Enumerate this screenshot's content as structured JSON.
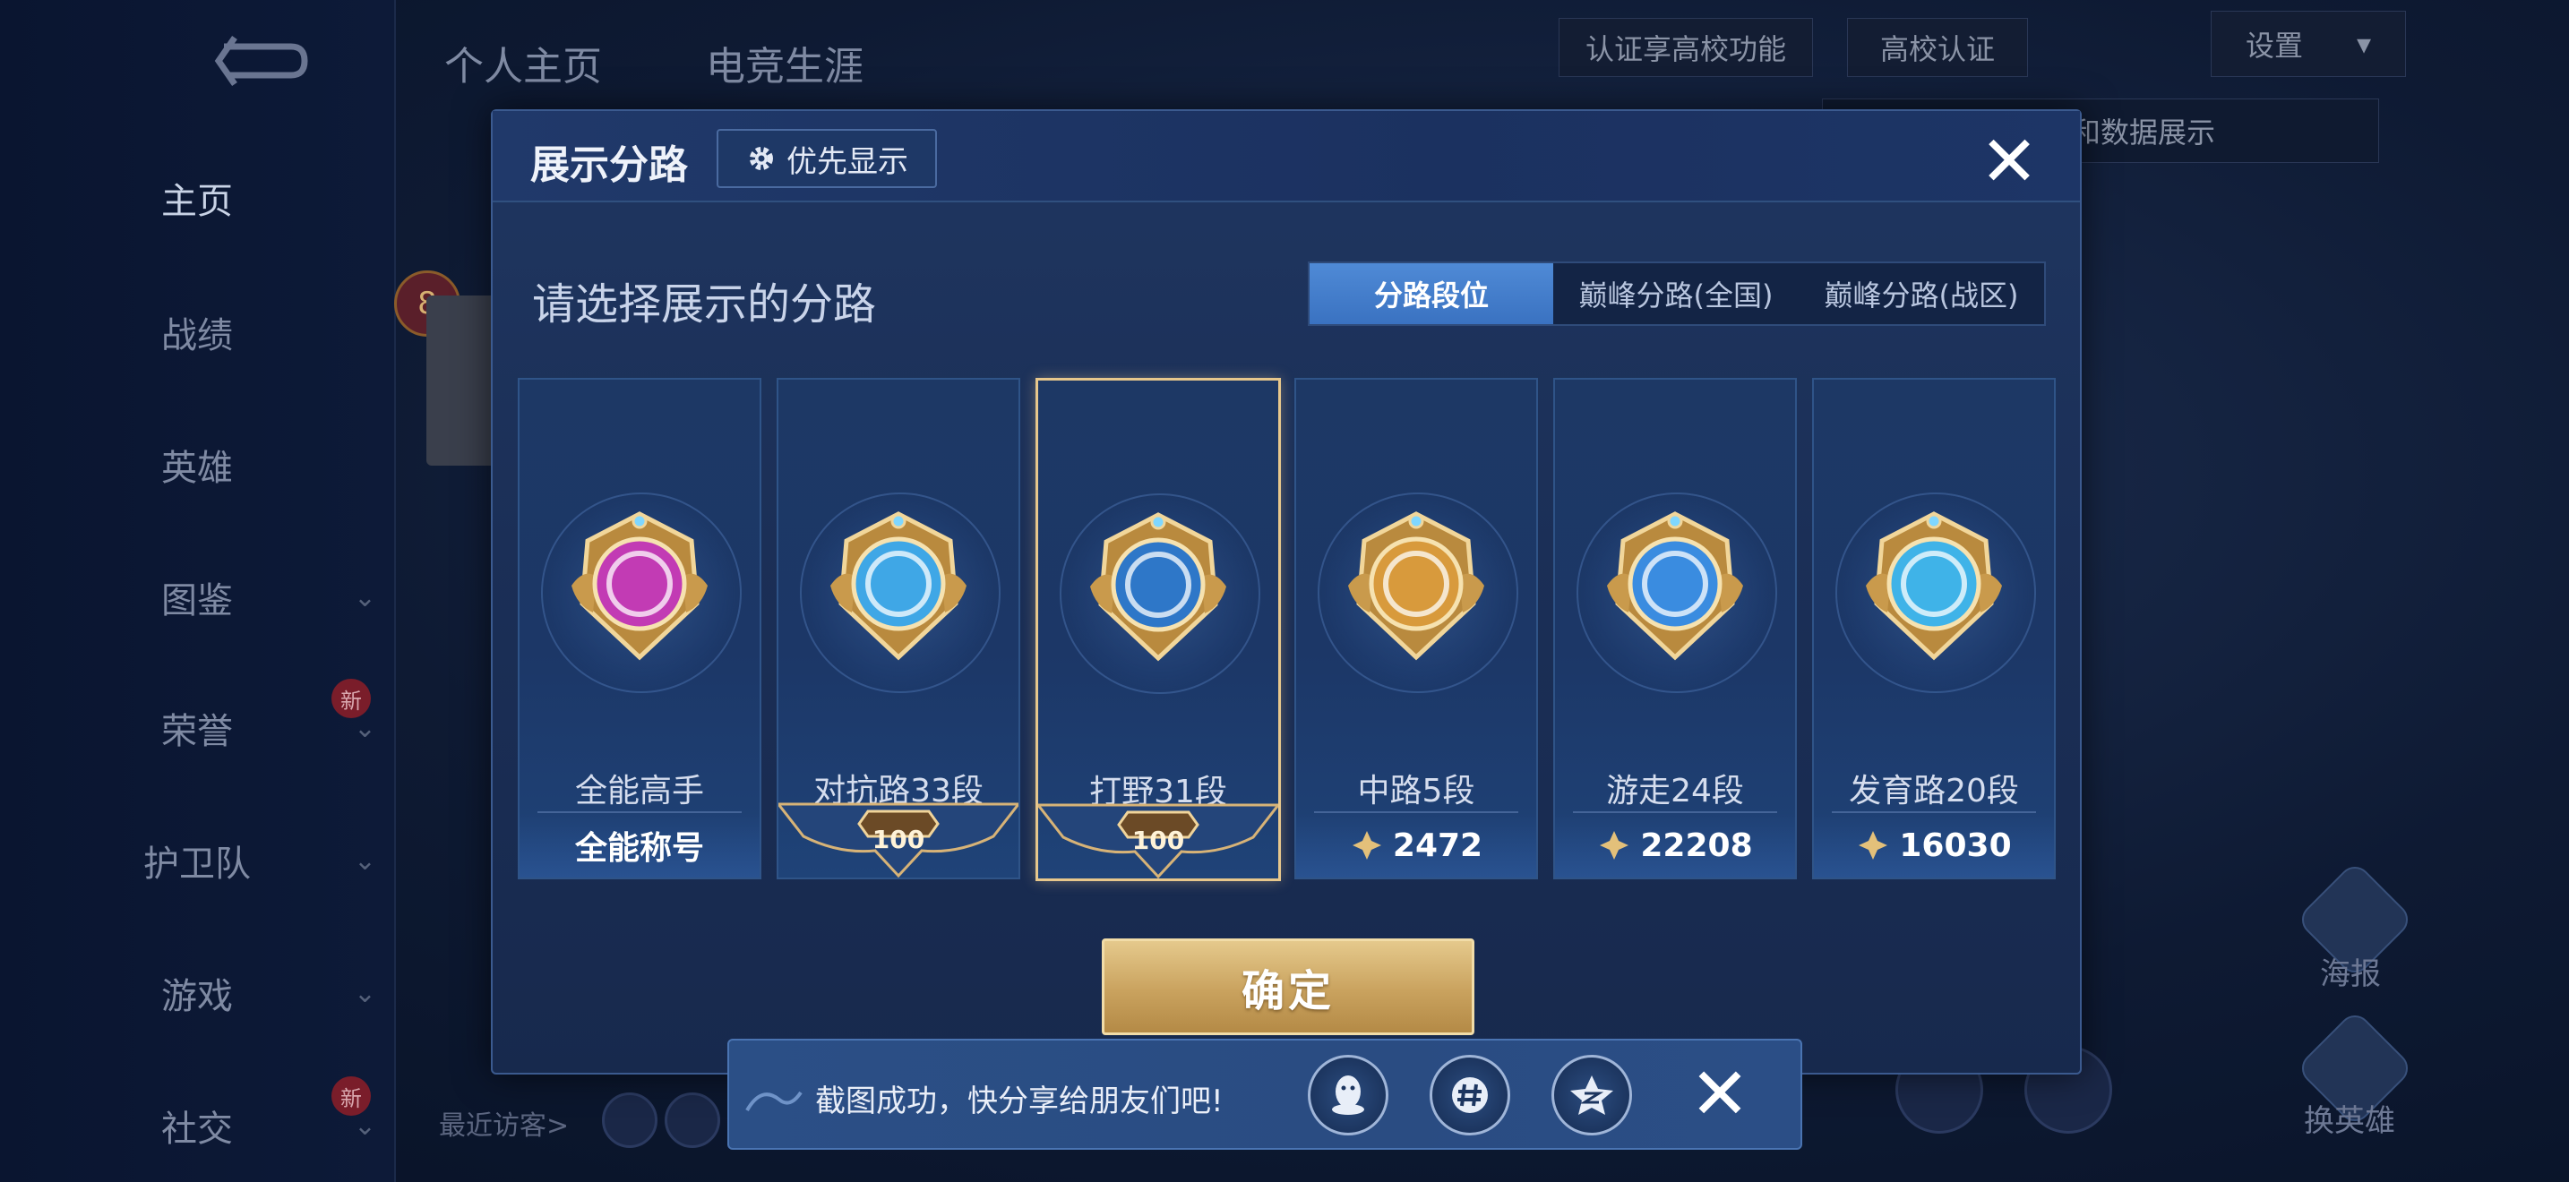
{
  "background": {
    "top_tabs": [
      "个人主页",
      "电竞生涯"
    ],
    "sidebar_items": [
      {
        "label": "主页",
        "active": true,
        "chevron": false,
        "new": false
      },
      {
        "label": "战绩",
        "active": false,
        "chevron": false,
        "new": false
      },
      {
        "label": "英雄",
        "active": false,
        "chevron": false,
        "new": false
      },
      {
        "label": "图鉴",
        "active": false,
        "chevron": true,
        "new": false
      },
      {
        "label": "荣誉",
        "active": false,
        "chevron": true,
        "new": true
      },
      {
        "label": "护卫队",
        "active": false,
        "chevron": true,
        "new": false
      },
      {
        "label": "游戏",
        "active": false,
        "chevron": true,
        "new": false
      },
      {
        "label": "社交",
        "active": false,
        "chevron": true,
        "new": true
      }
    ],
    "new_tag": "新",
    "auth_hint": "认证享高校功能",
    "campus_auth": "高校认证",
    "settings": "设置",
    "switch_hint": "换灵宝和数据展示",
    "level_badge": "8",
    "recent_visitors": "最近访客>",
    "right_buttons": [
      "海报",
      "换英雄"
    ]
  },
  "modal": {
    "title": "展示分路",
    "priority_label": "优先显示",
    "subtitle": "请选择展示的分路",
    "tabs": [
      {
        "label": "分路段位",
        "active": true
      },
      {
        "label": "巅峰分路(全国)",
        "active": false
      },
      {
        "label": "巅峰分路(战区)",
        "active": false
      }
    ],
    "cards": [
      {
        "name": "全能高手",
        "bottom": "全能称号",
        "type": "title",
        "selected": false,
        "color": "#c23bb4"
      },
      {
        "name": "对抗路33段",
        "bottom": "100",
        "type": "crest",
        "selected": false,
        "color": "#3fa7e6"
      },
      {
        "name": "打野31段",
        "bottom": "100",
        "type": "crest",
        "selected": true,
        "color": "#2e77c8"
      },
      {
        "name": "中路5段",
        "bottom": "2472",
        "type": "points",
        "selected": false,
        "color": "#d89a3c"
      },
      {
        "name": "游走24段",
        "bottom": "22208",
        "type": "points",
        "selected": false,
        "color": "#3a8ce0"
      },
      {
        "name": "发育路20段",
        "bottom": "16030",
        "type": "points",
        "selected": false,
        "color": "#3fb3e8"
      }
    ],
    "confirm_label": "确定"
  },
  "toast": {
    "text": "截图成功，快分享给朋友们吧!",
    "share_targets": [
      "qq-icon",
      "wechat-moments-icon",
      "qzone-icon"
    ]
  },
  "colors": {
    "accent_gold": "#e5c98c",
    "active_tab": "#4f8ad6",
    "panel_blue": "#1b2f57"
  }
}
